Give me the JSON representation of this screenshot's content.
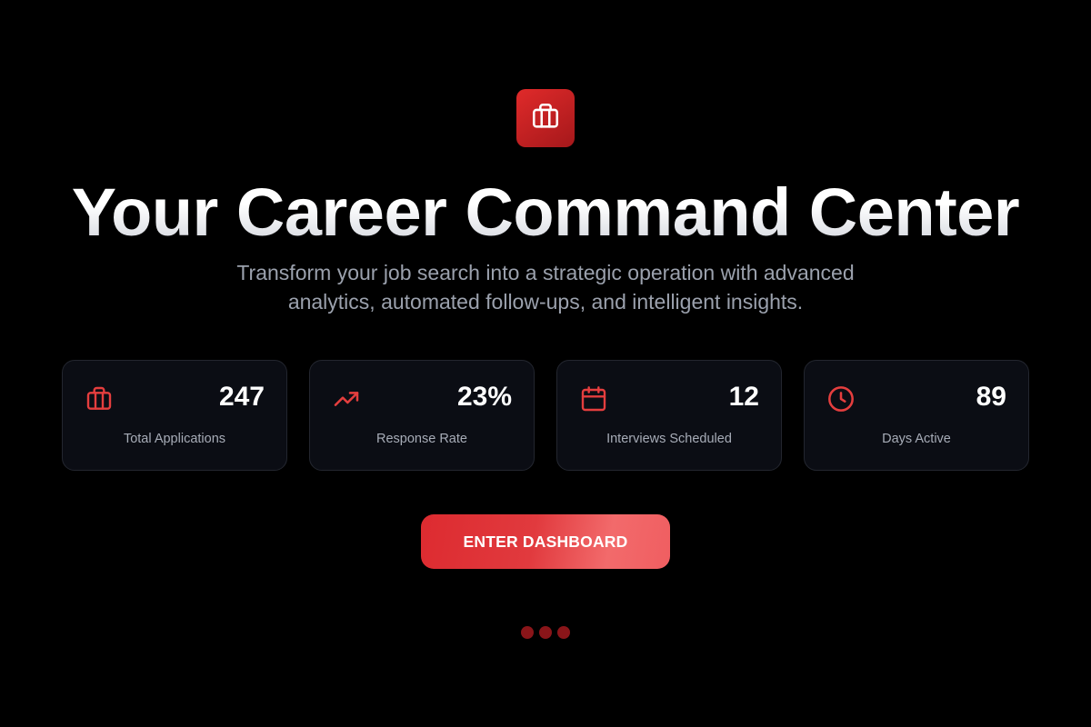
{
  "logo": {
    "icon": "briefcase-icon",
    "color": "#dc2626"
  },
  "hero": {
    "title": "Your Career Command Center",
    "subtitle_line1": "Transform your job search into a strategic operation with advanced",
    "subtitle_line2": "analytics, automated follow-ups, and intelligent insights."
  },
  "stats": [
    {
      "icon": "briefcase-icon",
      "value": "247",
      "label": "Total Applications"
    },
    {
      "icon": "trending-up-icon",
      "value": "23%",
      "label": "Response Rate"
    },
    {
      "icon": "calendar-icon",
      "value": "12",
      "label": "Interviews Scheduled"
    },
    {
      "icon": "clock-icon",
      "value": "89",
      "label": "Days Active"
    }
  ],
  "cta": {
    "label": "ENTER DASHBOARD"
  },
  "pagination": {
    "dot_count": 3
  },
  "colors": {
    "background": "#000000",
    "accent": "#e53e3e",
    "card_background": "#0b0d14",
    "card_border": "#23262f",
    "muted_text": "#9ba1ad"
  }
}
